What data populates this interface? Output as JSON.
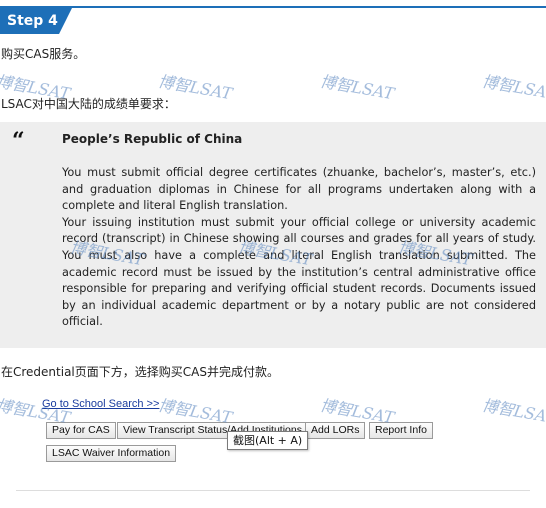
{
  "step_badge": "Step 4",
  "intro_text": "购买CAS服务。",
  "requirements_text": "LSAC对中国大陆的成绩单要求：",
  "quote": {
    "title": "People’s Republic of China",
    "body_lines": [
      "You must      submit official degree certificates (zhuanke, bachelor’s, master’s, etc.)      and graduation diplomas in Chinese for all programs undertaken along with      a complete and literal English translation.",
      "Your issuing        institution must submit your official college or university academic      record (transcript) in Chinese showing all courses and grades for all years of study. You must also have a complete and literal English translation submitted. The academic record must be issued by the institution’s central administrative office responsible for preparing and verifying official student records. Documents issued by an individual academic department or by a notary public are not considered official."
    ]
  },
  "instruction_text": "在Credential页面下方，选择购买CAS并完成付款。",
  "screenshot_panel": {
    "school_link": "Go to School Search >>",
    "buttons": [
      "Pay for CAS",
      "View Transcript Status/Add Institutions",
      "Add LORs",
      "Report Info",
      "LSAC Waiver Information"
    ],
    "tooltip": "截图(Alt + A)"
  },
  "watermark_text": "博智LSAT"
}
